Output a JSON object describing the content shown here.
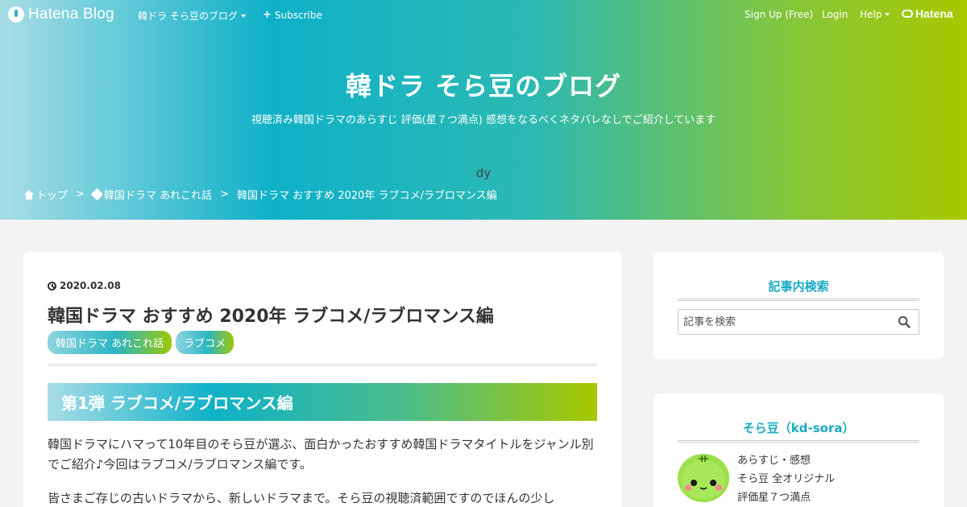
{
  "globalbar": {
    "brand": "Hatena Blog",
    "blog_menu": "韓ドラ そら豆のブログ",
    "subscribe": "Subscribe",
    "signup": "Sign Up (Free)",
    "login": "Login",
    "help": "Help",
    "hatena": "Hatena"
  },
  "header": {
    "title": "韓ドラ そら豆のブログ",
    "description": "視聴済み韓国ドラマのあらすじ 評価(星７つ満点) 感想をなるべくネタバレなしでご紹介しています",
    "ad_label": "dy"
  },
  "breadcrumb": {
    "home": "トップ",
    "category": "韓国ドラマ あれこれ話",
    "current": "韓国ドラマ おすすめ 2020年 ラブコメ/ラブロマンス編",
    "separator": ">"
  },
  "article": {
    "date": "2020.02.08",
    "title": "韓国ドラマ おすすめ 2020年 ラブコメ/ラブロマンス編",
    "tags": [
      "韓国ドラマ あれこれ話",
      "ラブコメ"
    ],
    "section_heading": "第1弾  ラブコメ/ラブロマンス編",
    "paragraph1": "韓国ドラマにハマって10年目のそら豆が選ぶ、面白かったおすすめ韓国ドラマタイトルをジャンル別でご紹介♪今回はラブコメ/ラブロマンス編です。",
    "paragraph2": "皆さまご存じの古いドラマから、新しいドラマまで。そら豆の視聴済範囲ですのでほんの少し"
  },
  "sidebar": {
    "search": {
      "heading": "記事内検索",
      "placeholder": "記事を検索"
    },
    "profile": {
      "heading": "そら豆（kd-sora）",
      "lines": [
        "あらすじ・感想",
        "そら豆 全オリジナル",
        "評価星７つ満点"
      ]
    }
  },
  "colors": {
    "accent": "#1aa9c4",
    "gradient_start": "#a8dde6",
    "gradient_end": "#a8c800"
  },
  "icons": [
    "hatena-blog-logo-icon",
    "caret-down-icon",
    "plus-icon",
    "hatena-logo-icon",
    "home-icon",
    "tag-icon",
    "clock-icon",
    "search-icon",
    "avatar-icon"
  ]
}
